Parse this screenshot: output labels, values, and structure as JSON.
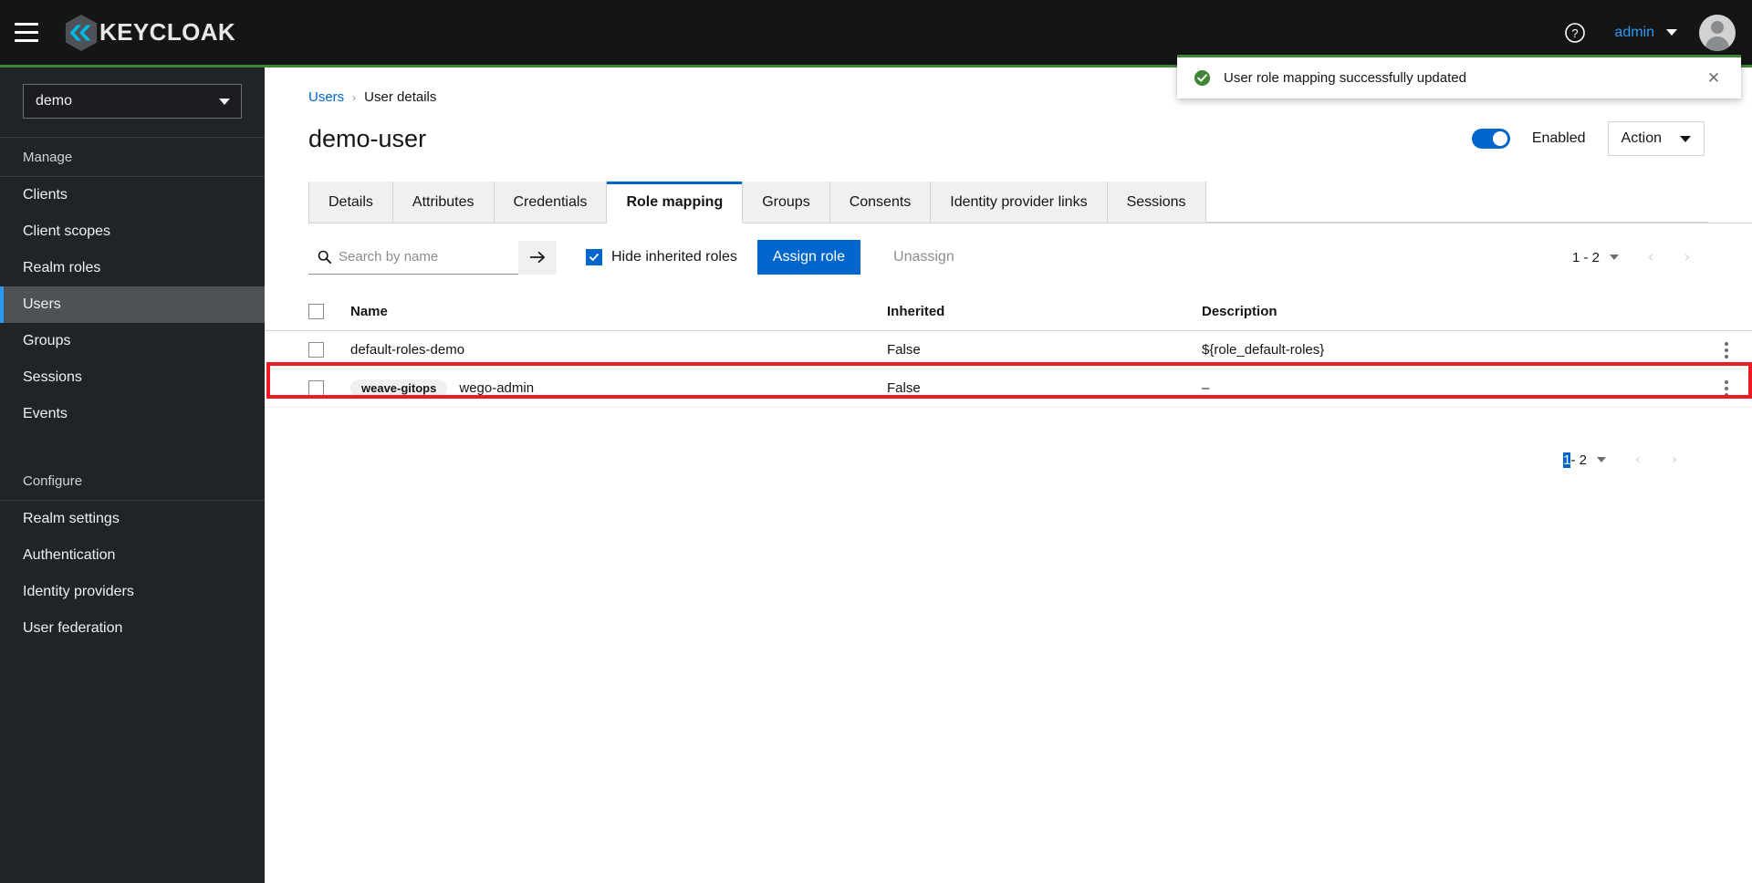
{
  "masthead": {
    "hamburger_label": "Global navigation",
    "brand": "KEYCLOAK",
    "help_label": "?",
    "user_name": "admin",
    "avatar_label": "User avatar"
  },
  "alert": {
    "message": "User role mapping successfully updated",
    "close_label": "✕",
    "variant_color": "#3e8635"
  },
  "sidebar": {
    "realm": {
      "selected": "demo"
    },
    "groups": [
      {
        "title": "Manage",
        "items": [
          {
            "label": "Clients",
            "active": false
          },
          {
            "label": "Client scopes",
            "active": false
          },
          {
            "label": "Realm roles",
            "active": false
          },
          {
            "label": "Users",
            "active": true
          },
          {
            "label": "Groups",
            "active": false
          },
          {
            "label": "Sessions",
            "active": false
          },
          {
            "label": "Events",
            "active": false
          }
        ]
      },
      {
        "title": "Configure",
        "items": [
          {
            "label": "Realm settings",
            "active": false
          },
          {
            "label": "Authentication",
            "active": false
          },
          {
            "label": "Identity providers",
            "active": false
          },
          {
            "label": "User federation",
            "active": false
          }
        ]
      }
    ]
  },
  "breadcrumb": {
    "parent": "Users",
    "separator": "›",
    "current": "User details"
  },
  "page": {
    "title": "demo-user",
    "enabled_label": "Enabled",
    "enabled_state": true,
    "action_label": "Action"
  },
  "tabs": [
    {
      "label": "Details",
      "active": false
    },
    {
      "label": "Attributes",
      "active": false
    },
    {
      "label": "Credentials",
      "active": false
    },
    {
      "label": "Role mapping",
      "active": true
    },
    {
      "label": "Groups",
      "active": false
    },
    {
      "label": "Consents",
      "active": false
    },
    {
      "label": "Identity provider links",
      "active": false
    },
    {
      "label": "Sessions",
      "active": false
    }
  ],
  "toolbar": {
    "search_placeholder": "Search by name",
    "search_value": "",
    "search_go_label": "→",
    "hide_inherited_label": "Hide inherited roles",
    "hide_inherited_checked": true,
    "assign_role_label": "Assign role",
    "unassign_label": "Unassign"
  },
  "pagination_top": {
    "range": "1 - 2",
    "prev_label": "‹",
    "next_label": "›"
  },
  "pagination_bottom": {
    "range_selected": "1",
    "range_rest": "- 2",
    "prev_label": "‹",
    "next_label": "›"
  },
  "table": {
    "columns": [
      "Name",
      "Inherited",
      "Description"
    ],
    "rows": [
      {
        "badge": "",
        "name": "default-roles-demo",
        "inherited": "False",
        "description": "${role_default-roles}",
        "highlighted": false
      },
      {
        "badge": "weave-gitops",
        "name": "wego-admin",
        "inherited": "False",
        "description": "–",
        "highlighted": true
      }
    ]
  }
}
